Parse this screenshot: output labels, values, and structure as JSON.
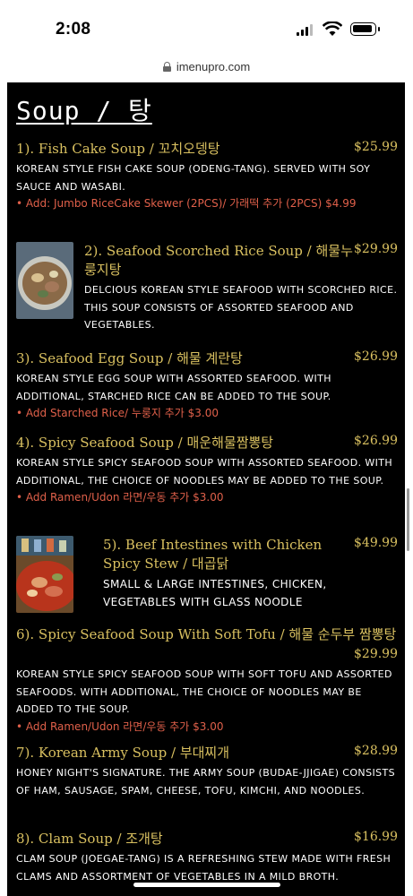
{
  "status_bar": {
    "time": "2:08"
  },
  "browser": {
    "url": "imenupro.com"
  },
  "menu": {
    "section_title": "Soup / 탕",
    "items": [
      {
        "title": "1). Fish Cake Soup / 꼬치오뎅탕",
        "price": "$25.99",
        "description": "Korean style fish cake soup (odeng-tang). Served with soy sauce and wasabi.",
        "addon": "• Add: Jumbo RiceCake Skewer (2PCS)/ 가래떡 추가 (2PCS) $4.99"
      },
      {
        "title": "2). Seafood Scorched Rice Soup / 해물누룽지탕",
        "price": "$29.99",
        "description": "Delcious Korean style seafood with scorched rice. This soup consists of assorted seafood and vegetables."
      },
      {
        "title": "3). Seafood Egg Soup / 해물 계란탕",
        "price": "$26.99",
        "description": "Korean style egg soup with assorted seafood. With additional, starched rice can be added to the soup.",
        "addon": "• Add Starched Rice/ 누룽지 추가 $3.00"
      },
      {
        "title": "4). Spicy Seafood Soup / 매운해물짬뽕탕",
        "price": "$26.99",
        "description": "Korean style spicy seafood soup with assorted seafood. With additional, the choice of noodles may be added to the soup.",
        "addon": "• Add Ramen/Udon 라면/우동 추가 $3.00"
      },
      {
        "title": "5). Beef Intestines with Chicken Spicy Stew / 대곱닭",
        "price": "$49.99",
        "description": "Small & large intestines, chicken, vegetables with glass noodle"
      },
      {
        "title": "6). Spicy Seafood Soup With Soft Tofu / 해물 순두부 짬뽕탕",
        "price": "$29.99",
        "description": "Korean style spicy seafood soup with soft tofu and assorted seafoods. With additional, the choice of noodles may be added to the soup.",
        "addon": "• Add Ramen/Udon 라면/우동 추가 $3.00"
      },
      {
        "title": "7). Korean Army Soup / 부대찌개",
        "price": "$28.99",
        "description": "Honey Night's signature. The army soup (budae-jjigae) consists of ham, sausage, spam, cheese, tofu, kimchi, and noodles."
      },
      {
        "title": "8). Clam Soup / 조개탕",
        "price": "$16.99",
        "description": "Clam soup (joegae-tang) is a refreshing stew made with fresh clams and assortment of vegetables in a mild broth."
      }
    ]
  },
  "colors": {
    "title": "#d9c060",
    "addon": "#e0604a",
    "background": "#000000"
  }
}
